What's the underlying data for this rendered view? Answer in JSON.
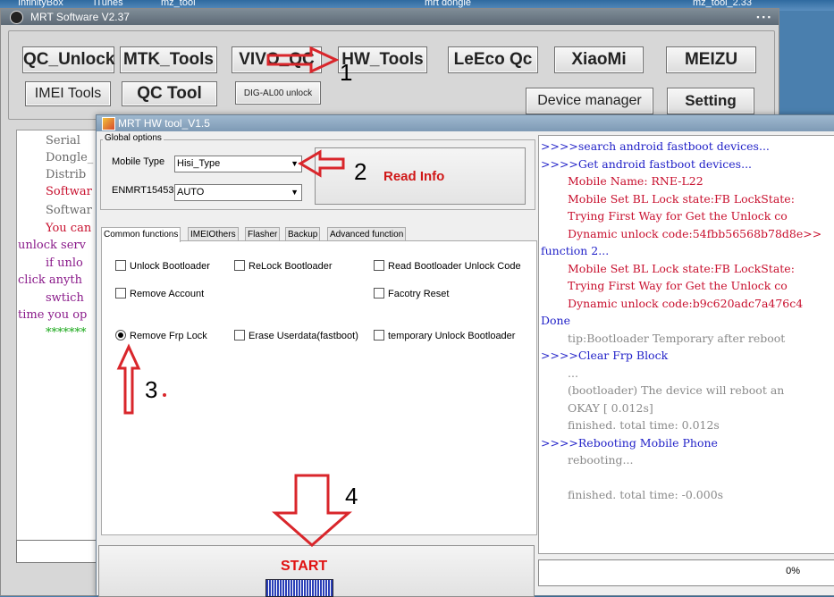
{
  "desktop": {
    "items": [
      "InfinityBox",
      "iTunes",
      "mz_tool",
      "mrt dongle",
      "mz_tool_2.33"
    ]
  },
  "main_window": {
    "title": "MRT Software V2.37",
    "buttons": {
      "qc_unlock": "QC_Unlock",
      "mtk_tools": "MTK_Tools",
      "vivo_qc": "VIVO_QC",
      "hw_tools": "HW_Tools",
      "leeco_qc": "LeEco Qc",
      "xiaomi": "XiaoMi",
      "meizu": "MEIZU",
      "imei_tools": "IMEI Tools",
      "qc_tool": "QC Tool",
      "dig_al00": "DIG-AL00 unlock",
      "device_manager": "Device manager",
      "setting": "Setting"
    },
    "partial_log": [
      {
        "text": "Serial",
        "color": "#6a6a6a"
      },
      {
        "text": "Dongle_",
        "color": "#6a6a6a"
      },
      {
        "text": "Distrib",
        "color": "#6a6a6a"
      },
      {
        "text": "Softwar",
        "color": "#c8102e"
      },
      {
        "text": "Softwar",
        "color": "#6a6a6a"
      },
      {
        "text": "You can",
        "color": "#c8102e"
      },
      {
        "text": "unlock serv",
        "color": "#8a1a8a"
      },
      {
        "text": "if unlo",
        "color": "#8a1a8a"
      },
      {
        "text": "click anyth",
        "color": "#8a1a8a"
      },
      {
        "text": "swtich",
        "color": "#8a1a8a"
      },
      {
        "text": "time you op",
        "color": "#8a1a8a"
      },
      {
        "text": "*******",
        "color": "#1aa81a"
      }
    ]
  },
  "hw_dialog": {
    "title": "MRT HW tool_V1.5",
    "global_options_label": "Global options",
    "mobile_type_label": "Mobile Type",
    "mobile_type_value": "Hisi_Type",
    "enmrt_label": "ENMRT15453",
    "enmrt_value": "AUTO",
    "read_info_label": "Read Info",
    "tabs": [
      "Common functions",
      "IMEIOthers",
      "Flasher",
      "Backup",
      "Advanced function"
    ],
    "options": {
      "unlock_bootloader": "Unlock Bootloader",
      "relock_bootloader": "ReLock Bootloader",
      "read_unlock_code": "Read Bootloader Unlock Code",
      "remove_account": "Remove Account",
      "factory_reset": "Facotry Reset",
      "remove_frp": "Remove Frp Lock",
      "erase_userdata": "Erase Userdata(fastboot)",
      "temp_unlock": "temporary Unlock Bootloader"
    },
    "start_label": "START",
    "progress_text": "0%",
    "log": [
      {
        "text": ">>>>search android fastboot devices...",
        "color": "#2222c8",
        "indent": 0
      },
      {
        "text": ">>>>Get android fastboot devices...",
        "color": "#2222c8",
        "indent": 0
      },
      {
        "text": "Mobile Name: RNE-L22",
        "color": "#c8102e",
        "indent": 1
      },
      {
        "text": "Mobile Set BL Lock state:FB LockState:",
        "color": "#c8102e",
        "indent": 1
      },
      {
        "text": "Trying First Way for Get the Unlock co",
        "color": "#c8102e",
        "indent": 1
      },
      {
        "text": "Dynamic unlock code:54fbb56568b78d8e>>",
        "color": "#c8102e",
        "indent": 1
      },
      {
        "text": "function 2...",
        "color": "#2222c8",
        "indent": 0
      },
      {
        "text": "Mobile Set BL Lock state:FB LockState:",
        "color": "#c8102e",
        "indent": 1
      },
      {
        "text": "Trying First Way for Get the Unlock co",
        "color": "#c8102e",
        "indent": 1
      },
      {
        "text": "Dynamic unlock code:b9c620adc7a476c4",
        "color": "#c8102e",
        "indent": 1
      },
      {
        "text": "Done",
        "color": "#2222c8",
        "indent": 0
      },
      {
        "text": "tip:Bootloader Temporary after reboot",
        "color": "#8a8a8a",
        "indent": 1
      },
      {
        "text": ">>>>Clear Frp Block",
        "color": "#2222c8",
        "indent": 0
      },
      {
        "text": "...",
        "color": "#8a8a8a",
        "indent": 1
      },
      {
        "text": "(bootloader) The device will reboot an",
        "color": "#8a8a8a",
        "indent": 1
      },
      {
        "text": "OKAY [  0.012s]",
        "color": "#8a8a8a",
        "indent": 1
      },
      {
        "text": "finished. total time: 0.012s",
        "color": "#8a8a8a",
        "indent": 1
      },
      {
        "text": ">>>>Rebooting Mobile Phone",
        "color": "#2222c8",
        "indent": 0
      },
      {
        "text": "rebooting...",
        "color": "#8a8a8a",
        "indent": 1
      },
      {
        "text": "",
        "color": "#8a8a8a",
        "indent": 1
      },
      {
        "text": "finished. total time: -0.000s",
        "color": "#8a8a8a",
        "indent": 1
      }
    ]
  },
  "annotations": {
    "step1": "1",
    "step2": "2",
    "step3": "3",
    "step4": "4",
    "arrow_color": "#d9262b"
  }
}
